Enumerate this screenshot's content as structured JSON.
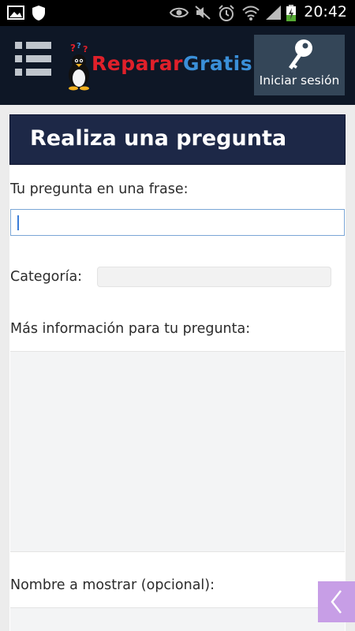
{
  "statusbar": {
    "time": "20:42",
    "icons": [
      "image-icon",
      "shield-icon",
      "eye-icon",
      "mute-icon",
      "alarm-icon",
      "wifi-icon",
      "signal-icon",
      "battery-charging-icon"
    ]
  },
  "appbar": {
    "menu_icon": "list-menu-icon",
    "logo_part1": "Reparar",
    "logo_part2": "Gratis",
    "login_label": "Iniciar sesión",
    "login_icon": "key-icon"
  },
  "form": {
    "title": "Realiza una pregunta",
    "question_label": "Tu pregunta en una frase:",
    "question_value": "",
    "category_label": "Categoría:",
    "category_value": "",
    "info_label": "Más información para tu pregunta:",
    "info_value": "",
    "name_label": "Nombre a mostrar (opcional):"
  },
  "side_tab": {
    "icon": "chevron-left-icon"
  },
  "colors": {
    "appbar_bg": "#0e1726",
    "title_bg": "#1d2847",
    "login_bg": "#344658",
    "logo_red": "#e0202a",
    "logo_blue": "#3a8fd8",
    "side_tab": "#c79ee6"
  }
}
